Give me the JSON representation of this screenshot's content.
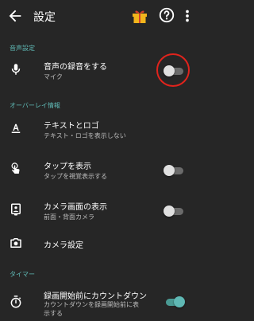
{
  "appbar": {
    "title": "設定"
  },
  "sections": {
    "voice": {
      "header": "音声設定"
    },
    "overlay": {
      "header": "オーバーレイ情報"
    },
    "timer": {
      "header": "タイマー"
    }
  },
  "items": {
    "record_audio": {
      "primary": "音声の録音をする",
      "secondary": "マイク",
      "toggle": "off"
    },
    "text_logo": {
      "primary": "テキストとロゴ",
      "secondary": "テキスト・ロゴを表示しない"
    },
    "show_taps": {
      "primary": "タップを表示",
      "secondary": "タップを視覚表示する",
      "toggle": "off"
    },
    "camera_view": {
      "primary": "カメラ画面の表示",
      "secondary": "前面・背面カメラ",
      "toggle": "off"
    },
    "camera_settings": {
      "primary": "カメラ設定"
    },
    "countdown": {
      "primary": "録画開始前にカウントダウン",
      "secondary_line1": "カウントダウンを録画開始前に表",
      "secondary_line2": "示する",
      "toggle": "on"
    }
  },
  "colors": {
    "background": "#262626",
    "accent": "#5fb8b4",
    "annotation": "#e0231c"
  }
}
